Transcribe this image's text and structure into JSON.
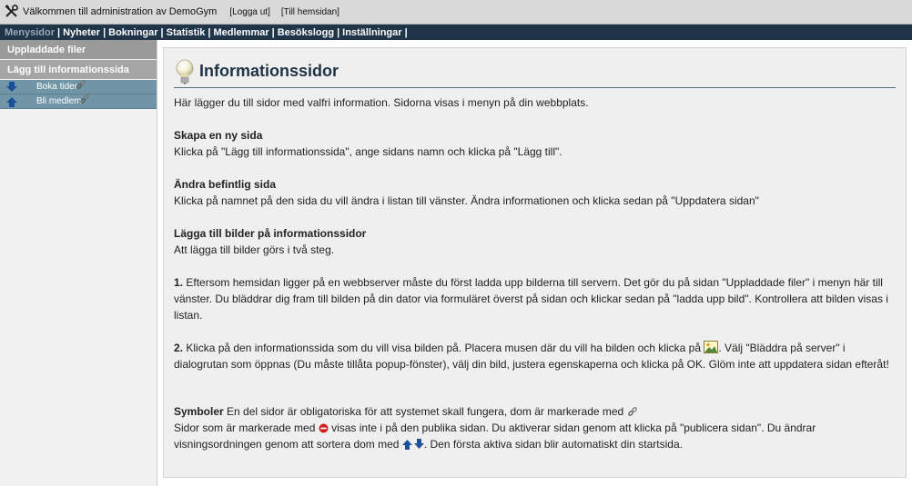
{
  "topbar": {
    "title": "Välkommen till administration av DemoGym",
    "logout": "[Logga ut]",
    "homepage": "[Till hemsidan]"
  },
  "menu": {
    "current": "Menysidor",
    "items": [
      "Nyheter",
      "Bokningar",
      "Statistik",
      "Medlemmar",
      "Besökslogg",
      "Inställningar"
    ],
    "separator": "|"
  },
  "sidebar": {
    "uploaded_files": "Uppladdade filer",
    "add_info_page": "Lägg till informationssida",
    "pages": [
      {
        "label": "Boka tider",
        "arrow": "arrow-down-icon"
      },
      {
        "label": "Bli medlem",
        "arrow": "arrow-up-icon"
      }
    ]
  },
  "content": {
    "title": "Informationssidor",
    "intro": "Här lägger du till sidor med valfri information. Sidorna visas i menyn på din webbplats.",
    "create_heading": "Skapa en ny sida",
    "create_text": "Klicka på \"Lägg till informationssida\", ange sidans namn och klicka på \"Lägg till\".",
    "edit_heading": "Ändra befintlig sida",
    "edit_text": "Klicka på namnet på den sida du vill ändra i listan till vänster. Ändra informationen och klicka sedan på \"Uppdatera sidan\"",
    "images_heading": "Lägga till bilder på informationssidor",
    "images_text": "Att lägga till bilder görs i två steg.",
    "step1_num": "1.",
    "step1_text": "Eftersom hemsidan ligger på en webbserver måste du först ladda upp bilderna till servern. Det gör du på sidan \"Uppladdade filer\" i menyn här till vänster. Du bläddrar dig fram till bilden på din dator via formuläret överst på sidan och klickar sedan på \"ladda upp bild\". Kontrollera att bilden visas i listan.",
    "step2_num": "2.",
    "step2_text_a": "Klicka på den informationssida som du vill visa bilden på. Placera musen där du vill ha bilden och klicka på",
    "step2_text_b": ". Välj \"Bläddra på server\" i dialogrutan som öppnas (Du måste tillåta popup-fönster), välj din bild, justera egenskaperna och klicka på OK. Glöm inte att uppdatera sidan efteråt!",
    "symbols_heading": "Symboler",
    "symbols_text_a": "En del sidor är obligatoriska för att systemet skall fungera, dom är markerade med",
    "symbols_text_b": "Sidor som är markerade med",
    "symbols_text_c": "visas inte i på den publika sidan. Du aktiverar sidan genom att klicka på \"publicera sidan\". Du ändrar visningsordningen genom att sortera dom med",
    "symbols_text_d": ". Den första aktiva sidan blir automatiskt din startsida."
  }
}
